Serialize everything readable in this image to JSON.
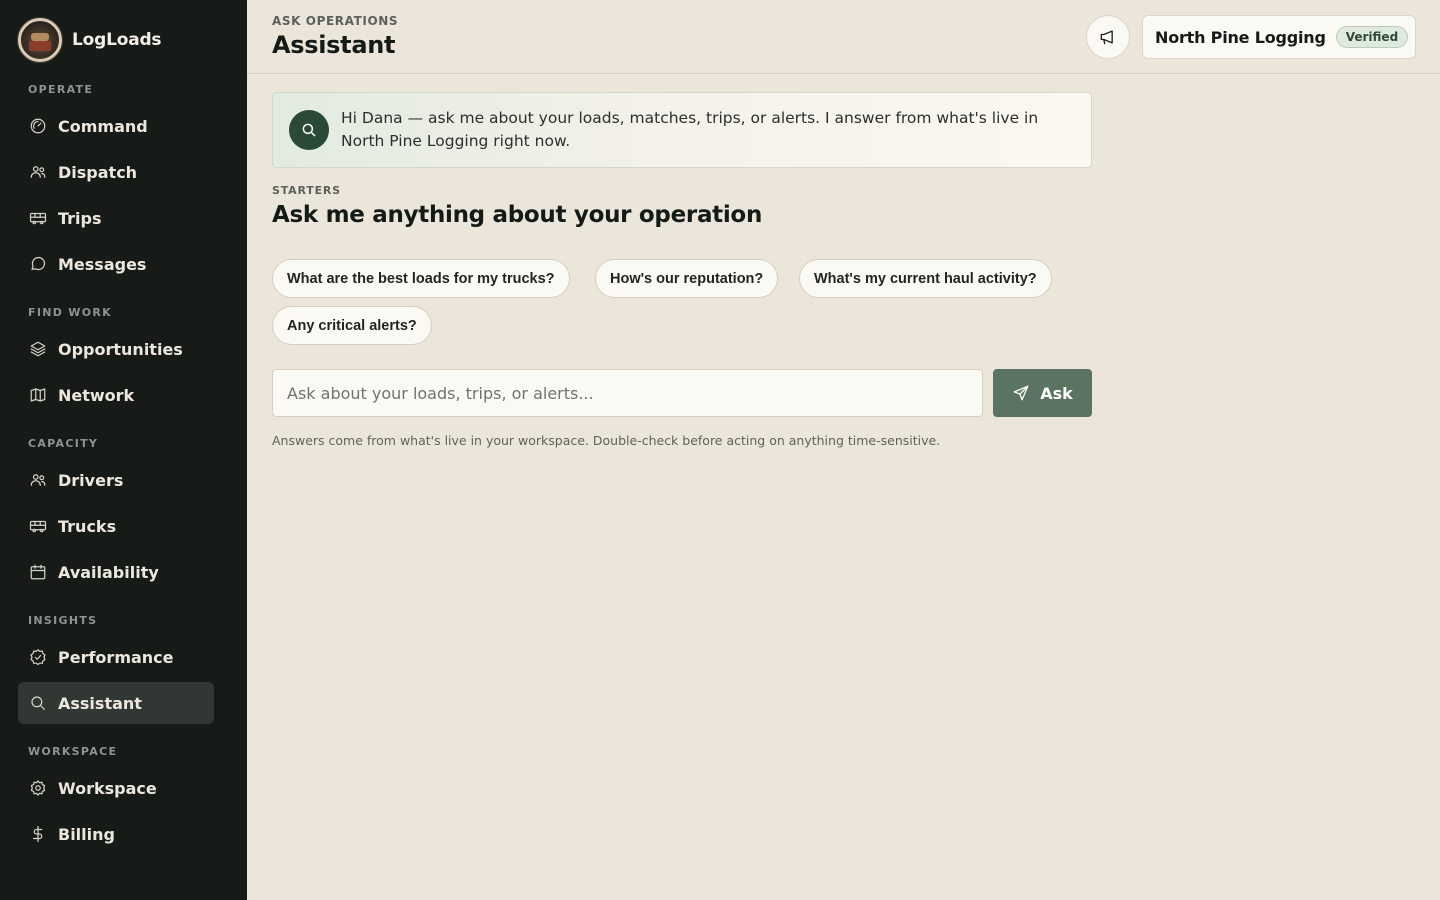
{
  "brand": {
    "name": "LogLoads"
  },
  "sidebar": {
    "sections": [
      {
        "label": "OPERATE",
        "items": [
          {
            "label": "Command",
            "icon": "gauge-icon"
          },
          {
            "label": "Dispatch",
            "icon": "users-icon"
          },
          {
            "label": "Trips",
            "icon": "truck-icon"
          },
          {
            "label": "Messages",
            "icon": "message-icon"
          }
        ]
      },
      {
        "label": "FIND WORK",
        "items": [
          {
            "label": "Opportunities",
            "icon": "layers-icon"
          },
          {
            "label": "Network",
            "icon": "map-icon"
          }
        ]
      },
      {
        "label": "CAPACITY",
        "items": [
          {
            "label": "Drivers",
            "icon": "users-icon"
          },
          {
            "label": "Trucks",
            "icon": "truck-icon"
          },
          {
            "label": "Availability",
            "icon": "calendar-icon"
          }
        ]
      },
      {
        "label": "INSIGHTS",
        "items": [
          {
            "label": "Performance",
            "icon": "badge-check-icon"
          },
          {
            "label": "Assistant",
            "icon": "search-icon",
            "active": true
          }
        ]
      },
      {
        "label": "WORKSPACE",
        "items": [
          {
            "label": "Workspace",
            "icon": "gear-icon"
          },
          {
            "label": "Billing",
            "icon": "dollar-icon"
          }
        ]
      }
    ]
  },
  "header": {
    "eyebrow": "ASK OPERATIONS",
    "title": "Assistant",
    "org_name": "North Pine Logging",
    "verified_label": "Verified"
  },
  "greeting": {
    "text": "Hi Dana — ask me about your loads, matches, trips, or alerts. I answer from what's live in North Pine Logging right now."
  },
  "starters": {
    "label": "STARTERS",
    "heading": "Ask me anything about your operation",
    "chips": [
      "What are the best loads for my trucks?",
      "How's our reputation?",
      "What's my current haul activity?",
      "Any critical alerts?"
    ]
  },
  "ask": {
    "placeholder": "Ask about your loads, trips, or alerts...",
    "value": "",
    "button_label": "Ask"
  },
  "disclaimer": "Answers come from what's live in your workspace. Double-check before acting on anything time-sensitive.",
  "colors": {
    "sidebar_bg": "#161b18",
    "page_bg": "#ece5d9",
    "accent": "#5b7461",
    "greeting_icon_bg": "#2a4a36"
  }
}
